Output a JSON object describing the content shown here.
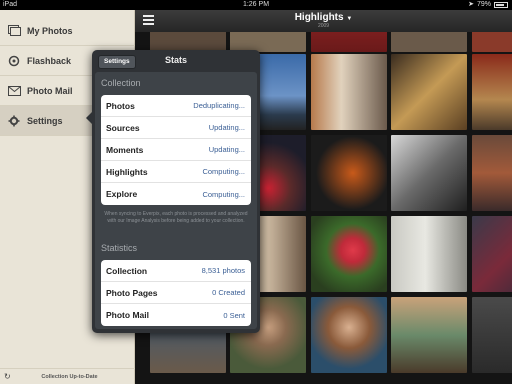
{
  "status_bar": {
    "device": "iPad",
    "time": "1:26 PM",
    "battery": "79%",
    "battery_level": 0.79
  },
  "sidebar": {
    "items": [
      {
        "label": "My Photos",
        "icon": "photos-icon"
      },
      {
        "label": "Flashback",
        "icon": "flashback-icon"
      },
      {
        "label": "Photo Mail",
        "icon": "mail-icon"
      },
      {
        "label": "Settings",
        "icon": "gear-icon"
      }
    ],
    "footer": "Collection Up-to-Date"
  },
  "header": {
    "title": "Highlights",
    "subtitle": "2009"
  },
  "stats_popover": {
    "back_label": "Settings",
    "title": "Stats",
    "collection_heading": "Collection",
    "collection_rows": [
      {
        "label": "Photos",
        "value": "Deduplicating..."
      },
      {
        "label": "Sources",
        "value": "Updating..."
      },
      {
        "label": "Moments",
        "value": "Updating..."
      },
      {
        "label": "Highlights",
        "value": "Computing..."
      },
      {
        "label": "Explore",
        "value": "Computing..."
      }
    ],
    "sync_note": "When syncing to Everpix, each photo is processed and analyzed with our Image Analysis before being added to your collection.",
    "statistics_heading": "Statistics",
    "statistics_rows": [
      {
        "label": "Collection",
        "value": "8,531 photos"
      },
      {
        "label": "Photo Pages",
        "value": "0 Created"
      },
      {
        "label": "Photo Mail",
        "value": "0 Sent"
      }
    ]
  },
  "colors": {
    "sidebar_bg": "#e9e4d7",
    "value_blue": "#3b5f95",
    "popover_bg": "#2f3236"
  }
}
